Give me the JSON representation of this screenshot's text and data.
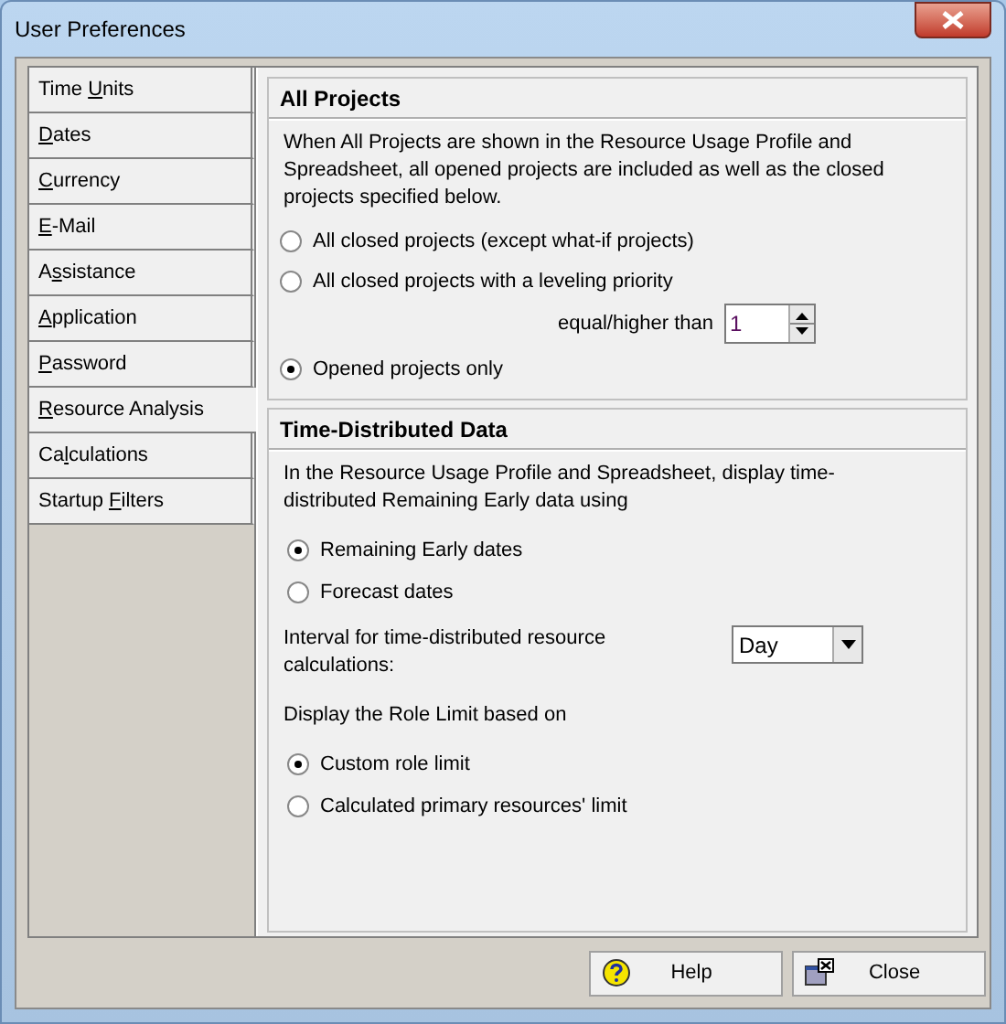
{
  "window": {
    "title": "User Preferences"
  },
  "tabs": [
    {
      "label": {
        "before": "Time ",
        "key": "U",
        "after": "nits"
      },
      "selected": false
    },
    {
      "label": {
        "key": "D",
        "after": "ates"
      },
      "selected": false
    },
    {
      "label": {
        "key": "C",
        "after": "urrency"
      },
      "selected": false
    },
    {
      "label": {
        "key": "E",
        "after": "-Mail"
      },
      "selected": false
    },
    {
      "label": {
        "before": "A",
        "key": "s",
        "after": "sistance"
      },
      "selected": false
    },
    {
      "label": {
        "key": "A",
        "after": "pplication"
      },
      "selected": false
    },
    {
      "label": {
        "key": "P",
        "after": "assword"
      },
      "selected": false
    },
    {
      "label": {
        "key": "R",
        "after": "esource Analysis"
      },
      "selected": true
    },
    {
      "label": {
        "before": "Ca",
        "key": "l",
        "after": "culations"
      },
      "selected": false
    },
    {
      "label": {
        "before": "Startup ",
        "key": "F",
        "after": "ilters"
      },
      "selected": false
    }
  ],
  "all_projects": {
    "heading": "All Projects",
    "description": "When All Projects are shown in the Resource Usage Profile and Spreadsheet, all opened projects are included as well as the closed projects specified below.",
    "options": [
      {
        "label": "All closed projects (except what-if projects)",
        "selected": false
      },
      {
        "label": "All closed projects with a leveling priority",
        "selected": false
      },
      {
        "label": "Opened projects only",
        "selected": true
      }
    ],
    "priority_label": "equal/higher than",
    "priority_value": "1"
  },
  "time_distributed": {
    "heading": "Time-Distributed Data",
    "description": "In the Resource Usage Profile and Spreadsheet, display time-distributed Remaining Early data using",
    "options": [
      {
        "label": "Remaining Early dates",
        "selected": true
      },
      {
        "label": "Forecast dates",
        "selected": false
      }
    ],
    "interval_label": "Interval for time-distributed resource calculations:",
    "interval_value": "Day",
    "role_limit_label": "Display the Role Limit based on",
    "role_options": [
      {
        "label": "Custom role limit",
        "selected": true
      },
      {
        "label": "Calculated primary resources' limit",
        "selected": false
      }
    ]
  },
  "buttons": [
    {
      "kind": "help",
      "label": "Help"
    },
    {
      "kind": "close",
      "label": "Close"
    }
  ]
}
